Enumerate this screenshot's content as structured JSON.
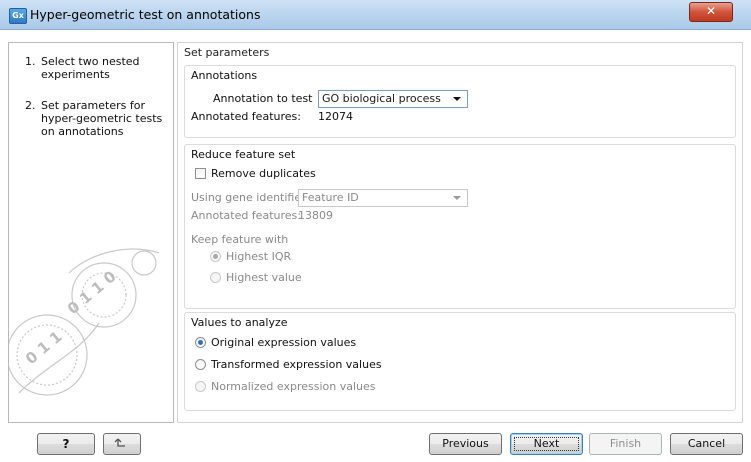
{
  "window": {
    "title": "Hyper-geometric test on annotations",
    "app_icon_text": "Gx",
    "close_symbol": "✕"
  },
  "steps": [
    {
      "number": "1.",
      "label": "Select two nested experiments"
    },
    {
      "number": "2.",
      "label": "Set parameters for hyper-geometric tests on annotations"
    }
  ],
  "page_heading": "Set parameters",
  "annotations": {
    "title": "Annotations",
    "annotation_to_test_label": "Annotation to test",
    "annotation_to_test_value": "GO biological process",
    "annotated_features_label": "Annotated features:",
    "annotated_features_value": "12074"
  },
  "reduce": {
    "title": "Reduce feature set",
    "remove_duplicates_label": "Remove duplicates",
    "remove_duplicates_checked": false,
    "gene_identifier_label": "Using gene identifier",
    "gene_identifier_value": "Feature ID",
    "annotated_features_label": "Annotated features:",
    "annotated_features_value": "13809",
    "keep_feature_label": "Keep feature with",
    "options": [
      {
        "label": "Highest IQR",
        "selected": true,
        "enabled": false
      },
      {
        "label": "Highest value",
        "selected": false,
        "enabled": false
      }
    ]
  },
  "values": {
    "title": "Values to analyze",
    "options": [
      {
        "label": "Original expression values",
        "selected": true,
        "enabled": true
      },
      {
        "label": "Transformed expression values",
        "selected": false,
        "enabled": true
      },
      {
        "label": "Normalized expression values",
        "selected": false,
        "enabled": false
      }
    ]
  },
  "buttons": {
    "help": "?",
    "reset_icon": "undo-arrow-icon",
    "previous": "Previous",
    "next": "Next",
    "finish": "Finish",
    "cancel": "Cancel"
  },
  "colors": {
    "titlebar": "#bcd6ef",
    "close": "#c03a22",
    "radio_selected": "#2f6fbd"
  }
}
